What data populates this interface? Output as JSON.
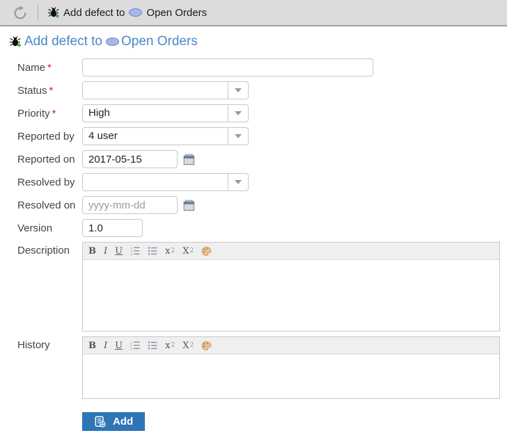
{
  "colors": {
    "accent_blue": "#2e75b6",
    "link_blue": "#4a87c7",
    "required_red": "#cc2222",
    "topbar_bg": "#dcdcdc"
  },
  "required_marker": "*",
  "topbar": {
    "action": "Add defect to",
    "entity": "Open Orders"
  },
  "heading": {
    "action": "Add defect to",
    "entity": "Open Orders"
  },
  "form": {
    "fields": {
      "name": {
        "label": "Name",
        "required": true,
        "value": ""
      },
      "status": {
        "label": "Status",
        "required": true,
        "value": ""
      },
      "priority": {
        "label": "Priority",
        "required": true,
        "value": "High"
      },
      "reported_by": {
        "label": "Reported by",
        "required": false,
        "value": "4 user"
      },
      "reported_on": {
        "label": "Reported on",
        "required": false,
        "value": "2017-05-15"
      },
      "resolved_by": {
        "label": "Resolved by",
        "required": false,
        "value": ""
      },
      "resolved_on": {
        "label": "Resolved on",
        "required": false,
        "value": "",
        "placeholder": "yyyy-mm-dd"
      },
      "version": {
        "label": "Version",
        "required": false,
        "value": "1.0"
      },
      "description": {
        "label": "Description",
        "required": false,
        "value": ""
      },
      "history": {
        "label": "History",
        "required": false,
        "value": ""
      }
    }
  },
  "editor_toolbar": {
    "bold": "B",
    "italic": "I",
    "underline": "U",
    "sup_base": "x",
    "sup_script": "2",
    "sub_base": "X",
    "sub_script": "2"
  },
  "add_button": {
    "label": "Add"
  }
}
